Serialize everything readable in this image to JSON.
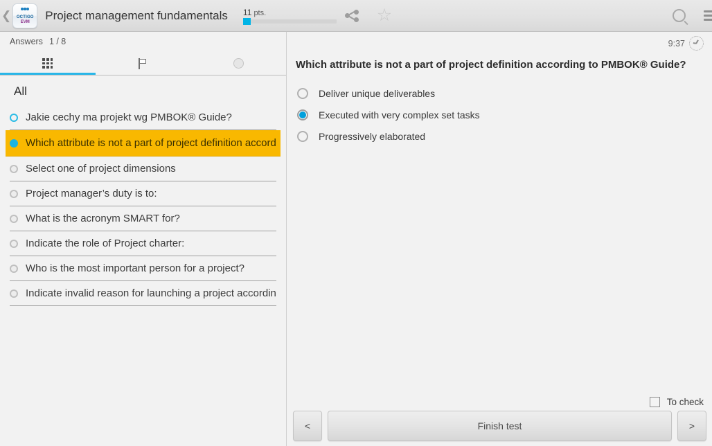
{
  "appbar": {
    "back_icon": "back-chevron-icon",
    "logo_word": "OCTIGO",
    "logo_sub": "EVM",
    "title": "Project management fundamentals",
    "points_value": "11",
    "points_unit": "pts.",
    "share_icon": "share-icon",
    "star_icon": "star-icon",
    "search_icon": "search-icon",
    "menu_icon": "hamburger-menu-icon"
  },
  "left_panel": {
    "answers_label": "Answers",
    "answers_count": "1 / 8",
    "tabs": [
      {
        "icon": "grid-icon",
        "active": true
      },
      {
        "icon": "flag-icon",
        "active": false
      },
      {
        "icon": "circle-icon",
        "active": false
      }
    ],
    "section_header": "All",
    "questions": [
      {
        "text": "Jakie cechy ma projekt wg PMBOK® Guide?",
        "state": "answered"
      },
      {
        "text": "Which attribute is not a part of project definition accordi",
        "state": "active"
      },
      {
        "text": "Select one of project dimensions",
        "state": "unanswered"
      },
      {
        "text": "Project manager’s duty is to:",
        "state": "unanswered"
      },
      {
        "text": "What is the acronym SMART for?",
        "state": "unanswered"
      },
      {
        "text": "Indicate the role of Project charter:",
        "state": "unanswered"
      },
      {
        "text": "Who is the most important person for a project?",
        "state": "unanswered"
      },
      {
        "text": "Indicate invalid reason for launching a project according",
        "state": "unanswered"
      }
    ]
  },
  "right_panel": {
    "timer": "9:37",
    "timer_icon": "clock-icon",
    "question": "Which attribute is not a part of project definition according to PMBOK® Guide?",
    "options": [
      {
        "label": "Deliver unique deliverables",
        "selected": false
      },
      {
        "label": "Executed with very complex set tasks",
        "selected": true
      },
      {
        "label": "Progressively elaborated",
        "selected": false
      }
    ],
    "to_check_label": "To check",
    "to_check_checked": false,
    "prev_label": "<",
    "finish_label": "Finish test",
    "next_label": ">"
  },
  "colors": {
    "accent_cyan": "#00a0dc",
    "highlight_amber": "#f9b800",
    "tab_underline": "#29b6e8",
    "panel_bg": "#f2f2f2"
  }
}
